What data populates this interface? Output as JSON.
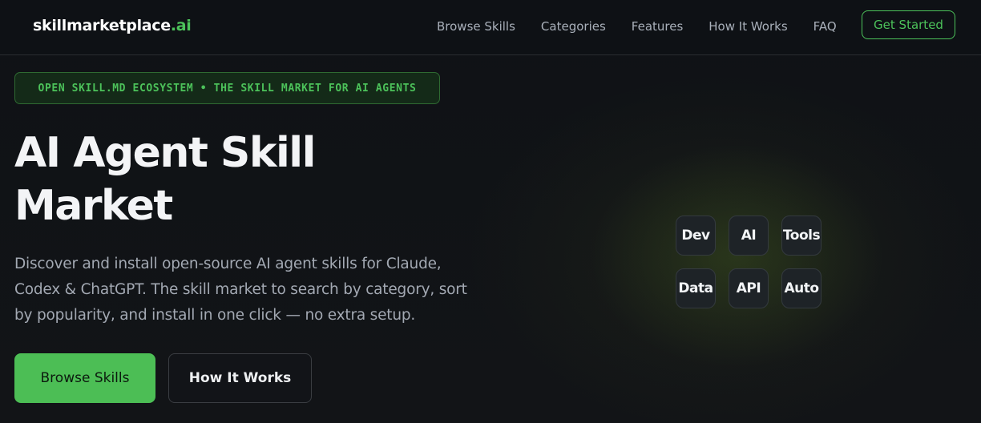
{
  "nav": {
    "logo_main": "skillmarketplace",
    "logo_accent": ".ai",
    "links": [
      {
        "label": "Browse Skills"
      },
      {
        "label": "Categories"
      },
      {
        "label": "Features"
      },
      {
        "label": "How It Works"
      },
      {
        "label": "FAQ"
      }
    ],
    "cta_label": "Get Started"
  },
  "hero": {
    "badge": "OPEN SKILL.MD ECOSYSTEM • THE SKILL MARKET FOR AI AGENTS",
    "title_line1": "AI Agent Skill",
    "title_line2": "Market",
    "description": "Discover and install open-source AI agent skills for Claude, Codex & ChatGPT. The skill market to search by category, sort by popularity, and install in one click — no extra setup.",
    "primary_button": "Browse Skills",
    "secondary_button": "How It Works"
  },
  "tiles": [
    {
      "label": "Dev"
    },
    {
      "label": "AI"
    },
    {
      "label": "Tools"
    },
    {
      "label": "Data"
    },
    {
      "label": "API"
    },
    {
      "label": "Auto"
    }
  ],
  "colors": {
    "accent": "#4cc25a",
    "background": "#0f1216",
    "tile_bg": "#1e2327"
  }
}
